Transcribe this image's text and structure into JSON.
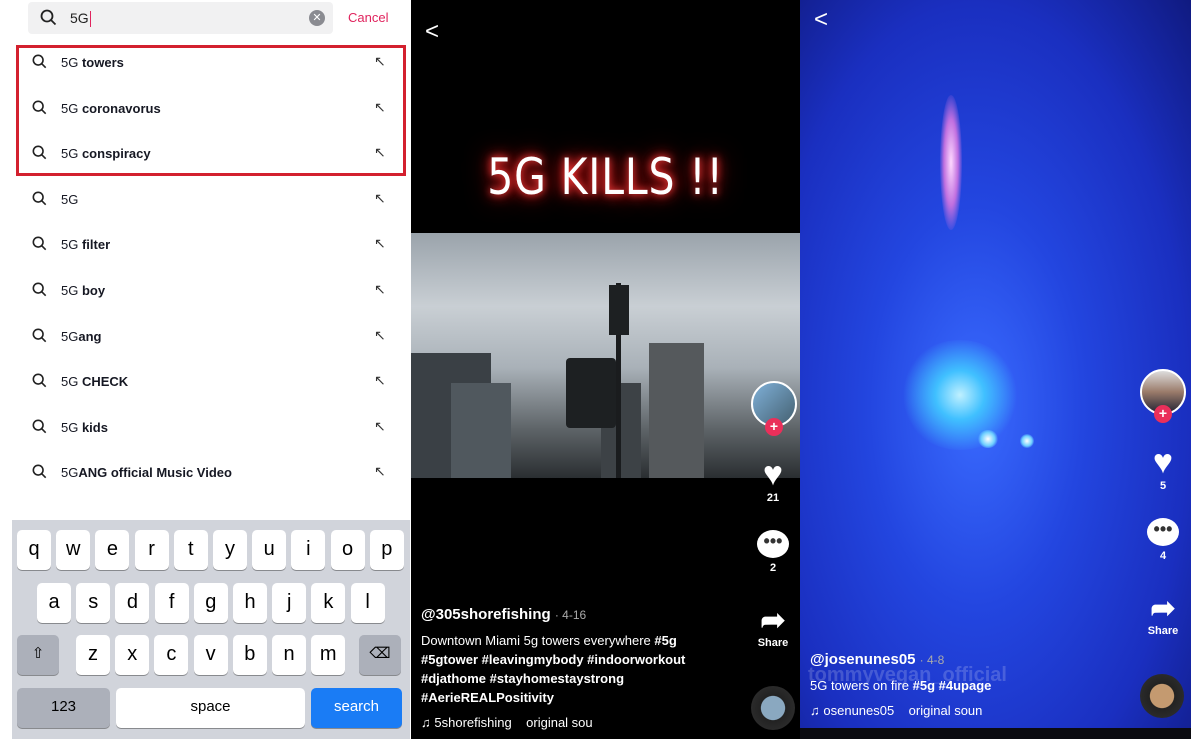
{
  "search": {
    "value": "5G",
    "cancel_label": "Cancel",
    "icon": "search-icon"
  },
  "suggestions": [
    {
      "prefix": "5G",
      "rest": " towers",
      "highlighted": true
    },
    {
      "prefix": "5G",
      "rest": " coronavorus",
      "highlighted": true
    },
    {
      "prefix": "5G",
      "rest": " conspiracy",
      "highlighted": true
    },
    {
      "prefix": "5G",
      "rest": "",
      "highlighted": false
    },
    {
      "prefix": "5G",
      "rest": " filter",
      "highlighted": false
    },
    {
      "prefix": "5G",
      "rest": " boy",
      "highlighted": false
    },
    {
      "prefix": "5G",
      "rest": "ang",
      "highlighted": false
    },
    {
      "prefix": "5G",
      "rest": " CHECK",
      "highlighted": false
    },
    {
      "prefix": "5G",
      "rest": " kids",
      "highlighted": false
    },
    {
      "prefix": "5G",
      "rest": "ANG official Music Video",
      "highlighted": false
    }
  ],
  "keyboard": {
    "row1": [
      "q",
      "w",
      "e",
      "r",
      "t",
      "y",
      "u",
      "i",
      "o",
      "p"
    ],
    "row2": [
      "a",
      "s",
      "d",
      "f",
      "g",
      "h",
      "j",
      "k",
      "l"
    ],
    "row3": [
      "z",
      "x",
      "c",
      "v",
      "b",
      "n",
      "m"
    ],
    "shift": "⇧",
    "delete": "⌫",
    "numbers": "123",
    "space": "space",
    "search": "search"
  },
  "video1": {
    "overlay_text": "5G KILLS !!",
    "likes": "21",
    "comments": "2",
    "share_label": "Share",
    "username": "@305shorefishing",
    "date": "· 4-16",
    "caption": "Downtown Miami 5g towers everywhere ",
    "hashtags_line1": "#5g",
    "hashtags_line2": "#5gtower #leavingmybody #indoorworkout",
    "hashtags_line3": "#djathome #stayhomestaystrong",
    "hashtags_line4": "#AerieREALPositivity",
    "music": "5shorefishing    original sou"
  },
  "video2": {
    "likes": "5",
    "comments": "4",
    "share_label": "Share",
    "username": "@josenunes05",
    "date": "· 4-8",
    "watermark": "tommyvegan_official",
    "caption": "5G towers on fire ",
    "hashtags": "#5g #4upage",
    "music": "osenunes05    original soun"
  },
  "colors": {
    "accent": "#e0245e",
    "highlight_box": "#d3202e",
    "search_key": "#1a7cf5"
  }
}
